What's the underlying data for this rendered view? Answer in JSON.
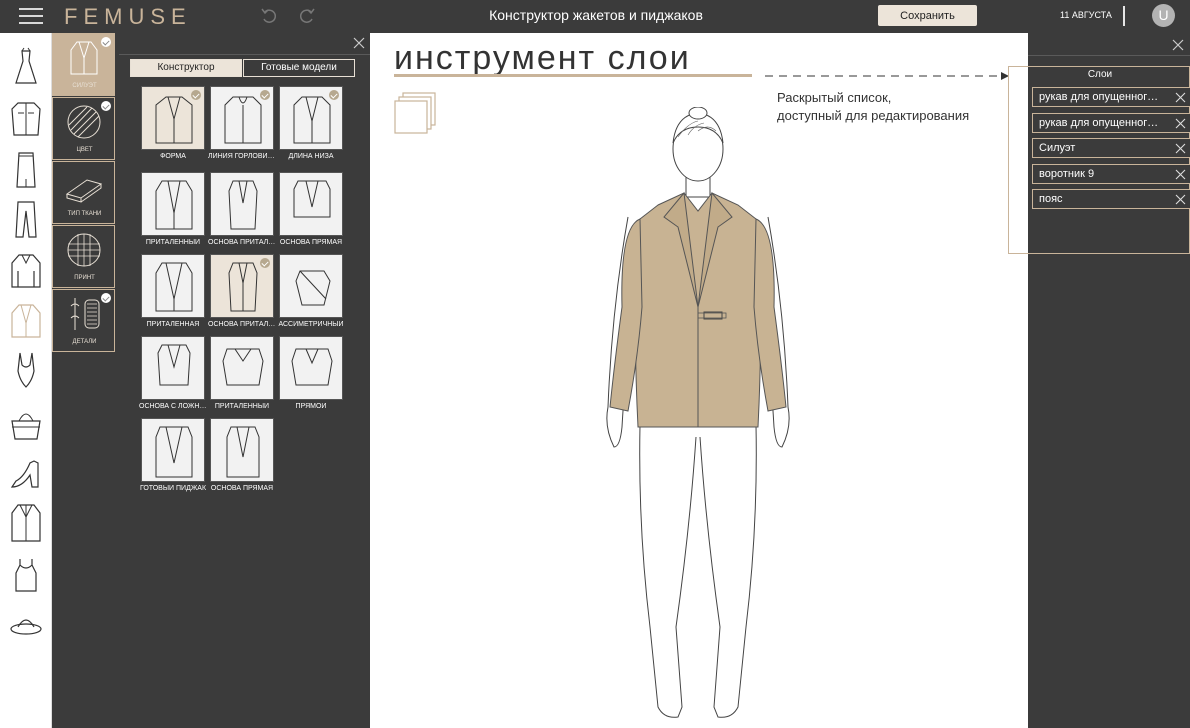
{
  "header": {
    "logo": "FEMUSE",
    "title": "Конструктор жакетов и пиджаков",
    "save_label": "Сохранить",
    "date": "11 АВГУСТА",
    "avatar_initial": "U"
  },
  "rail": {
    "items": [
      {
        "icon": "dress-icon"
      },
      {
        "icon": "shirt-icon"
      },
      {
        "icon": "skirt-icon"
      },
      {
        "icon": "trousers-icon"
      },
      {
        "icon": "sweater-icon"
      },
      {
        "icon": "jacket-icon",
        "active": true
      },
      {
        "icon": "swimsuit-icon"
      },
      {
        "icon": "bag-icon"
      },
      {
        "icon": "heel-shoe-icon"
      },
      {
        "icon": "coat-icon"
      },
      {
        "icon": "tank-top-icon"
      },
      {
        "icon": "hat-icon"
      }
    ]
  },
  "categories": [
    {
      "label": "СИЛУЭТ",
      "icon": "silhouette-icon",
      "checked": true,
      "active": true
    },
    {
      "label": "ЦВЕТ",
      "icon": "color-icon",
      "checked": true
    },
    {
      "label": "ТИП ТКАНИ",
      "icon": "fabric-icon",
      "checked": false
    },
    {
      "label": "ПРИНТ",
      "icon": "print-icon",
      "checked": false
    },
    {
      "label": "ДЕТАЛИ",
      "icon": "details-icon",
      "checked": true
    }
  ],
  "catalog": {
    "tabs": [
      {
        "label": "Конструктор",
        "active": true
      },
      {
        "label": "Готовые модели",
        "active": false
      }
    ],
    "tiles": [
      {
        "label": "ФОРМА",
        "selected": true,
        "checked": true
      },
      {
        "label": "ЛИНИЯ ГОРЛОВИНЫ",
        "selected": false,
        "checked": true
      },
      {
        "label": "ДЛИНА НИЗА",
        "selected": false,
        "checked": true
      },
      {
        "label": "ПРИТАЛЕННЫЙ",
        "selected": false,
        "checked": false
      },
      {
        "label": "ОСНОВА ПРИТАЛЕННАЯ",
        "selected": false,
        "checked": false
      },
      {
        "label": "ОСНОВА ПРЯМАЯ",
        "selected": false,
        "checked": false
      },
      {
        "label": "ПРИТАЛЕННАЯ",
        "selected": false,
        "checked": false
      },
      {
        "label": "ОСНОВА ПРИТАЛЕННАЯ",
        "selected": true,
        "checked": true
      },
      {
        "label": "АССИМЕТРИЧНЫЙ",
        "selected": false,
        "checked": false
      },
      {
        "label": "ОСНОВА С ЛОЖНЫМ",
        "selected": false,
        "checked": false
      },
      {
        "label": "ПРИТАЛЕННЫЙ",
        "selected": false,
        "checked": false
      },
      {
        "label": "ПРЯМОЙ",
        "selected": false,
        "checked": false
      },
      {
        "label": "ГОТОВЫЙ ПИДЖАК",
        "selected": false,
        "checked": false
      },
      {
        "label": "ОСНОВА ПРЯМАЯ",
        "selected": false,
        "checked": false
      }
    ]
  },
  "canvas": {
    "heading": "инструмент слои",
    "annotation_line1": "Раскрытый список,",
    "annotation_line2": "доступный для редактирования"
  },
  "layers": {
    "title": "Слои",
    "items": [
      "рукав для опущенного плеча",
      "рукав для опущенного плеча",
      "Силуэт",
      "воротник 9",
      "пояс"
    ]
  },
  "colors": {
    "background": "#3b3b3b",
    "accent": "#c9b49a",
    "garment": "#c8b393",
    "panel_light": "#ece4d9"
  }
}
